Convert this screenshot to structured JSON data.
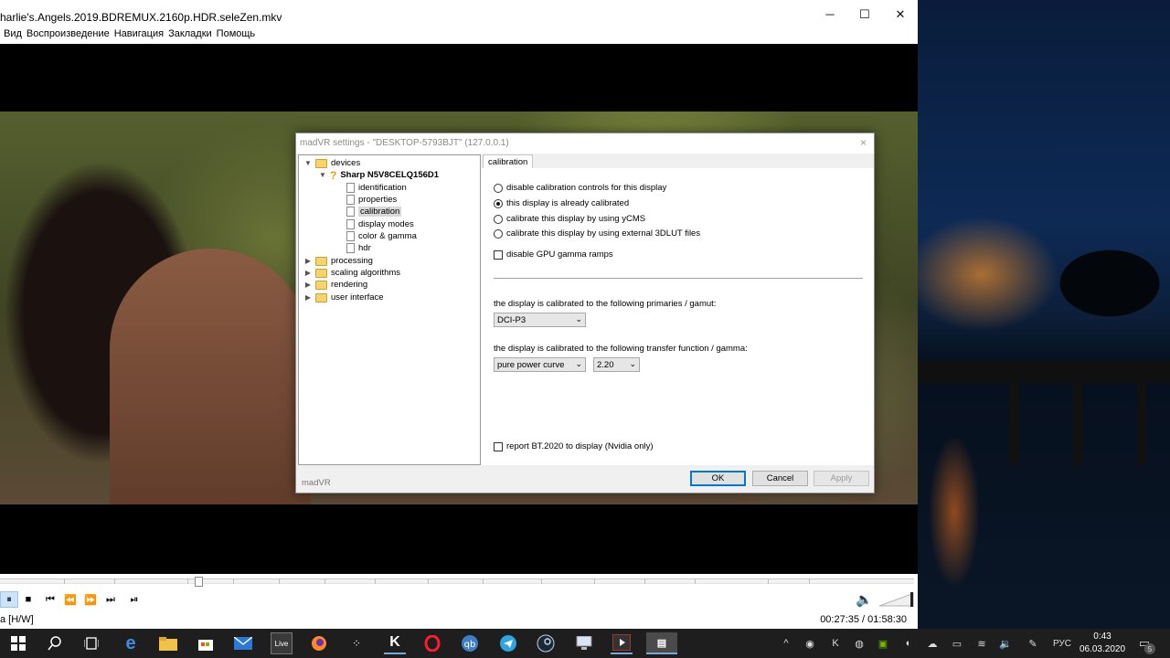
{
  "player": {
    "title": "harlie's.Angels.2019.BDREMUX.2160p.HDR.seleZen.mkv",
    "window_controls": {
      "minimize": "─",
      "maximize": "☐",
      "close": "✕"
    },
    "menu": [
      "Вид",
      "Воспроизведение",
      "Навигация",
      "Закладки",
      "Помощь"
    ],
    "seek_progress": 0.217,
    "controls": {
      "pause": "⏸",
      "stop": "■",
      "prev": "⏮",
      "rewind": "⏪",
      "forward": "⏩",
      "next": "⏭",
      "frame_step": "⏯"
    },
    "volume_icon": "🔈",
    "status_left": "a [H/W]",
    "status_time": "00:27:35 / 01:58:30"
  },
  "dialog": {
    "title": "madVR settings - \"DESKTOP-5793BJT\" (127.0.0.1)",
    "close": "×",
    "tree": {
      "devices": "devices",
      "device": "Sharp N5V8CELQ156D1",
      "children": [
        "identification",
        "properties",
        "calibration",
        "display modes",
        "color & gamma",
        "hdr"
      ],
      "selected": "calibration",
      "folders": [
        "processing",
        "scaling algorithms",
        "rendering",
        "user interface"
      ]
    },
    "tab": "calibration",
    "radios": [
      {
        "label": "disable calibration controls for this display",
        "checked": false
      },
      {
        "label": "this display is already calibrated",
        "checked": true
      },
      {
        "label": "calibrate this display by using yCMS",
        "checked": false
      },
      {
        "label": "calibrate this display by using external 3DLUT files",
        "checked": false
      }
    ],
    "gpu_ramps": "disable GPU gamma ramps",
    "primaries_label": "the display is calibrated to the following primaries / gamut:",
    "primaries_value": "DCI-P3",
    "transfer_label": "the display is calibrated to the following transfer function / gamma:",
    "transfer_value": "pure power curve",
    "gamma_value": "2.20",
    "bt2020": "report BT.2020 to display  (Nvidia only)",
    "footer": "madVR",
    "buttons": {
      "ok": "OK",
      "cancel": "Cancel",
      "apply": "Apply"
    }
  },
  "taskbar": {
    "tray_language": "РУС",
    "time": "0:43",
    "date": "06.03.2020",
    "notification_count": "5"
  }
}
